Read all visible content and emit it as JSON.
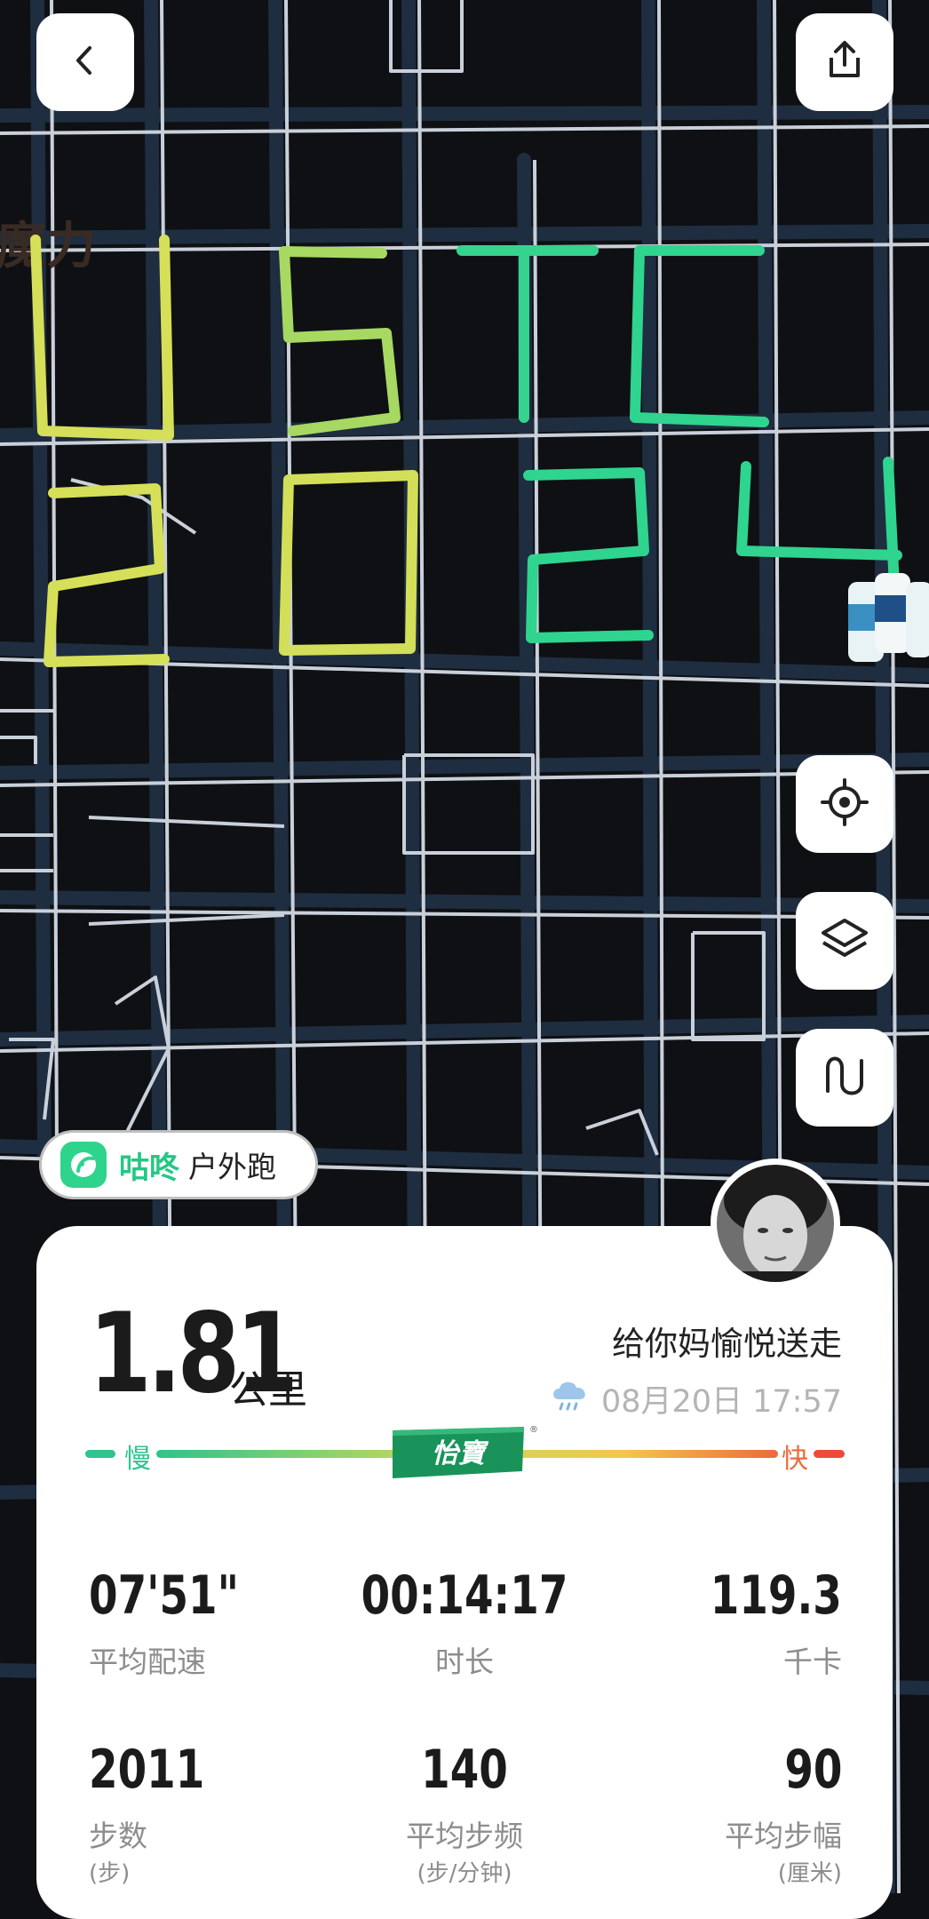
{
  "map_overlay": {
    "watermark_text": "魔力",
    "route_text": "USTC 2024"
  },
  "colors": {
    "route_gradient": [
      "#d6e05a",
      "#2fd48f"
    ],
    "pace_slow": "#2ec48c",
    "pace_fast": "#ee6a3a"
  },
  "icons": {
    "back": "chevron-left-icon",
    "share": "share-icon",
    "locate": "locate-icon",
    "layers": "layers-icon",
    "route_mode": "route-curve-icon"
  },
  "brand": {
    "name": "咕咚",
    "activity_type": "户外跑"
  },
  "summary": {
    "distance": "1.81",
    "distance_unit": "公里",
    "run_title": "给你妈愉悦送走",
    "datetime": "08月20日 17:57",
    "weather_icon": "rain-cloud-icon"
  },
  "pace_bar": {
    "slow_label": "慢",
    "fast_label": "快",
    "sponsor_logo": "怡寶"
  },
  "stats": [
    {
      "value": "07'51\"",
      "label": "平均配速",
      "sub": ""
    },
    {
      "value": "00:14:17",
      "label": "时长",
      "sub": ""
    },
    {
      "value": "119.3",
      "label": "千卡",
      "sub": ""
    },
    {
      "value": "2011",
      "label": "步数",
      "sub": "(步)"
    },
    {
      "value": "140",
      "label": "平均步频",
      "sub": "(步/分钟)"
    },
    {
      "value": "90",
      "label": "平均步幅",
      "sub": "(厘米)"
    }
  ]
}
